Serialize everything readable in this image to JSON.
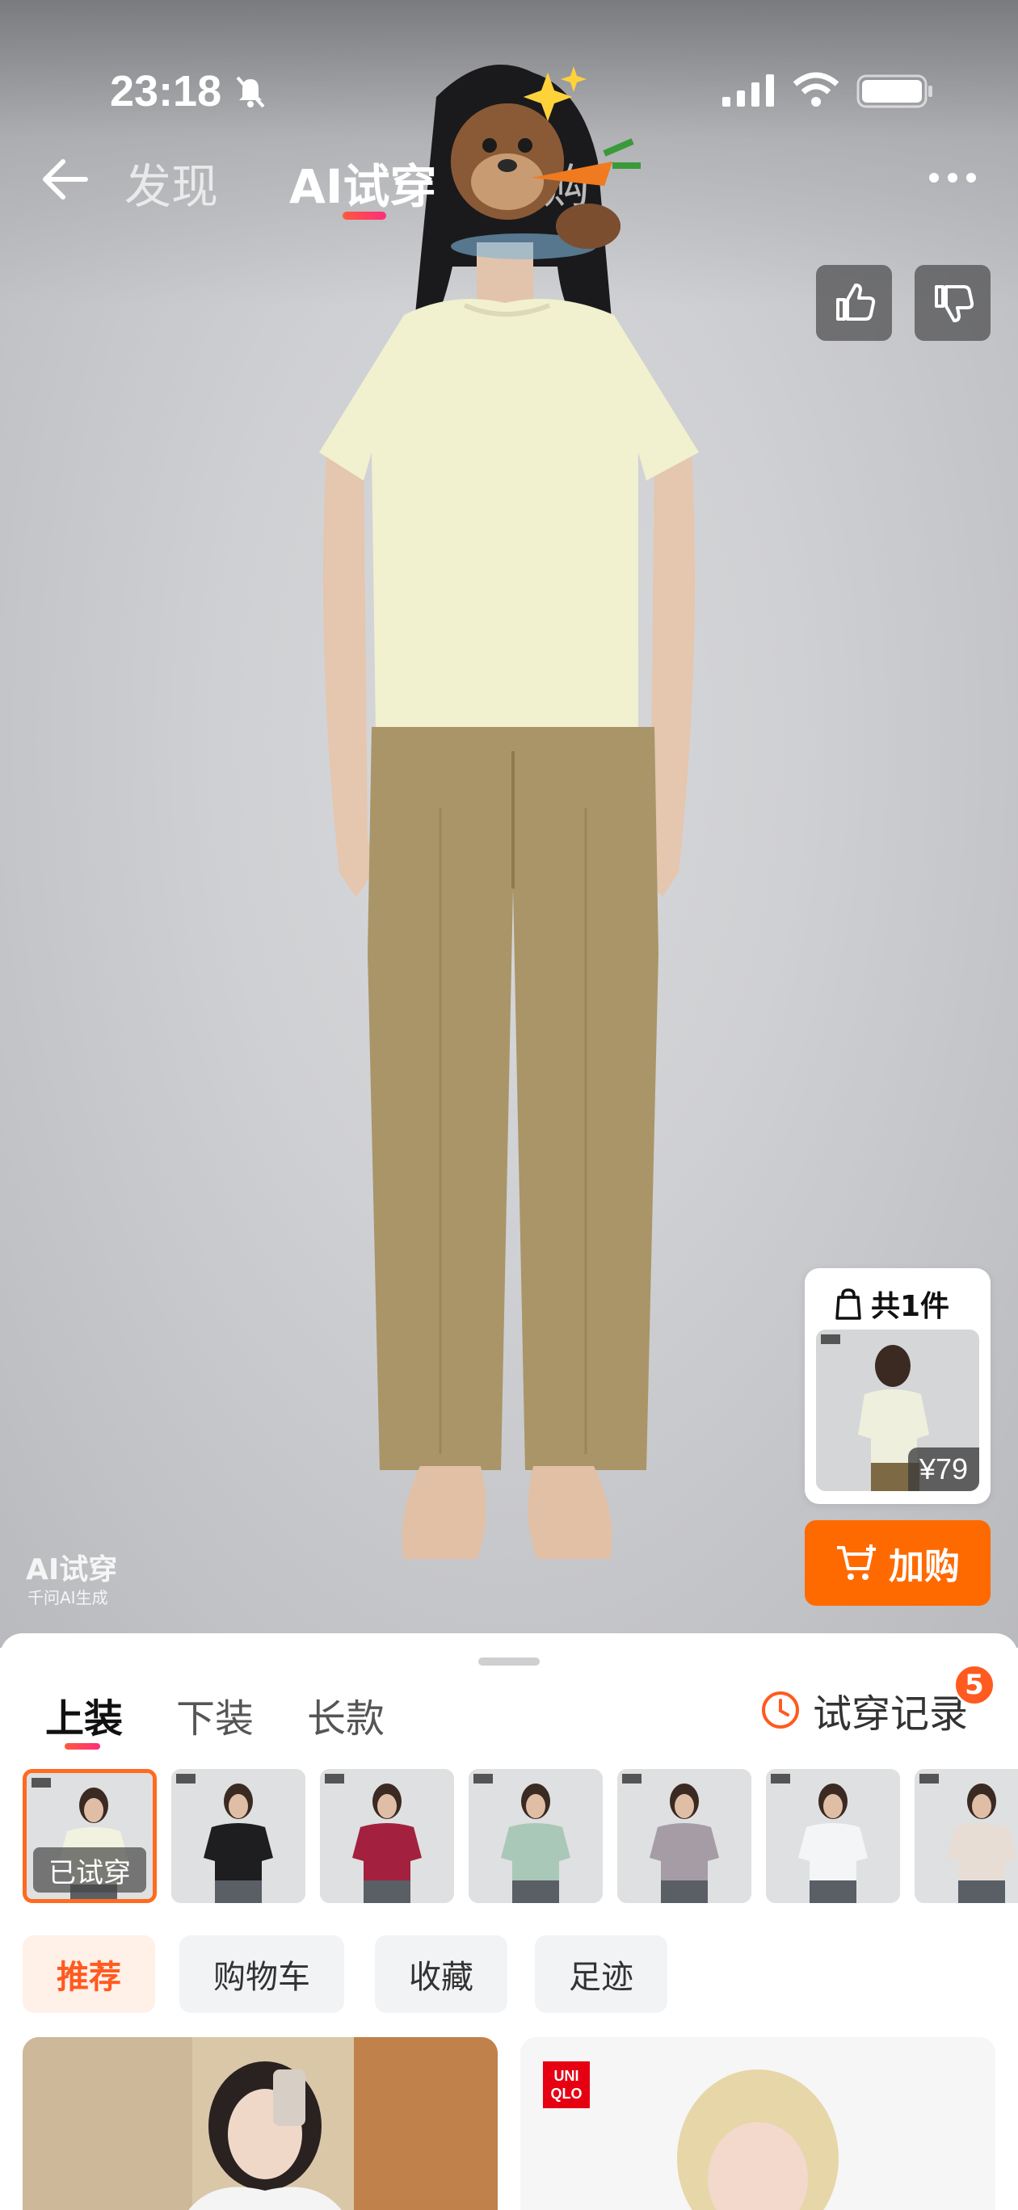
{
  "status_bar": {
    "time": "23:18"
  },
  "nav": {
    "tabs": [
      {
        "label": "发现"
      },
      {
        "label": "AI试穿"
      },
      {
        "label": "购"
      }
    ]
  },
  "watermark": {
    "title": "AI试穿",
    "subtitle": "千问AI生成"
  },
  "outfit": {
    "count_label": "共1件",
    "price": "¥79"
  },
  "buy_button": {
    "label": "加购"
  },
  "categories": {
    "tabs": [
      {
        "label": "上装"
      },
      {
        "label": "下装"
      },
      {
        "label": "长款"
      }
    ],
    "history_label": "试穿记录",
    "history_count": "5"
  },
  "thumbnails": {
    "selected_label": "已试穿",
    "items": [
      {
        "shirt": "#f1f3e0"
      },
      {
        "shirt": "#1e1e20"
      },
      {
        "shirt": "#a3213f"
      },
      {
        "shirt": "#a9c8b8"
      },
      {
        "shirt": "#a59ca6"
      },
      {
        "shirt": "#f4f5f7"
      },
      {
        "shirt": "#e8ddd5"
      }
    ]
  },
  "filters": [
    {
      "label": "推荐"
    },
    {
      "label": "购物车"
    },
    {
      "label": "收藏"
    },
    {
      "label": "足迹"
    }
  ],
  "feed": {
    "brand_logo": [
      "UNI",
      "QLO"
    ]
  },
  "colors": {
    "accent": "#ff6a00",
    "tab_gradient_start": "#ff5a3c",
    "tab_gradient_end": "#ff2d7a"
  }
}
